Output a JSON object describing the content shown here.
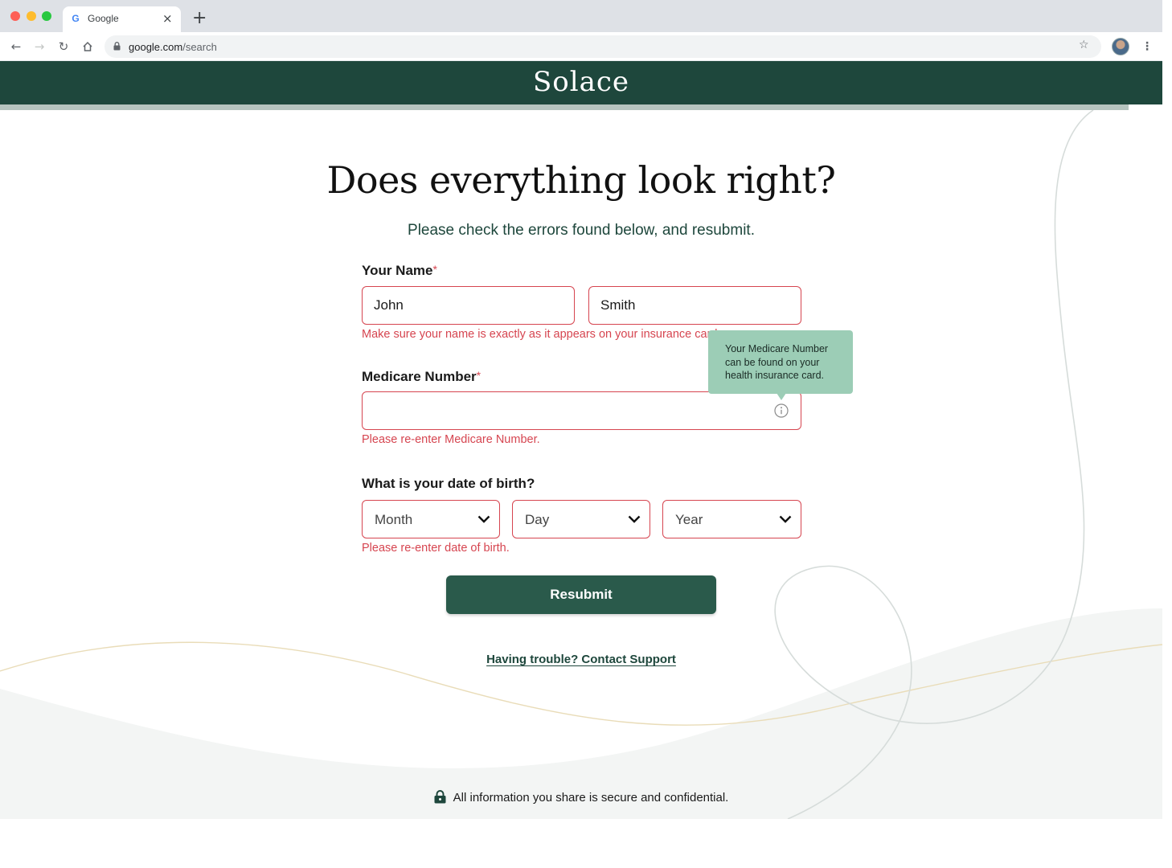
{
  "browser": {
    "tab_favicon": "G",
    "tab_title": "Google",
    "tab_close": "×",
    "new_tab": "+",
    "url_host": "google.com",
    "url_path": "/search",
    "icons": [
      "back-icon",
      "forward-icon",
      "reload-icon",
      "home-icon",
      "lock-icon",
      "star-icon",
      "avatar",
      "kebab-menu-icon"
    ]
  },
  "site": {
    "logo": "Solace",
    "colors": {
      "brand": "#1e473c",
      "button": "#2a5a4b",
      "error": "#d64550",
      "tooltip": "#9ccdb6"
    }
  },
  "form": {
    "title": "Does everything look right?",
    "subtitle": "Please check the errors found below, and resubmit.",
    "name": {
      "label": "Your Name",
      "required_mark": "*",
      "first_value": "John",
      "last_value": "Smith",
      "error": "Make sure your name is exactly as it appears on your insurance card."
    },
    "medicare": {
      "label": "Medicare Number",
      "required_mark": "*",
      "value": "",
      "error": "Please re-enter Medicare Number.",
      "tooltip": "Your Medicare Number can be found on your health insurance card."
    },
    "dob": {
      "label": "What is your date of birth?",
      "month": "Month",
      "day": "Day",
      "year": "Year",
      "error": "Please re-enter date of birth."
    },
    "submit_label": "Resubmit",
    "support_link": "Having trouble? Contact Support"
  },
  "footer": {
    "secure_text": "All information you share is secure and confidential."
  }
}
